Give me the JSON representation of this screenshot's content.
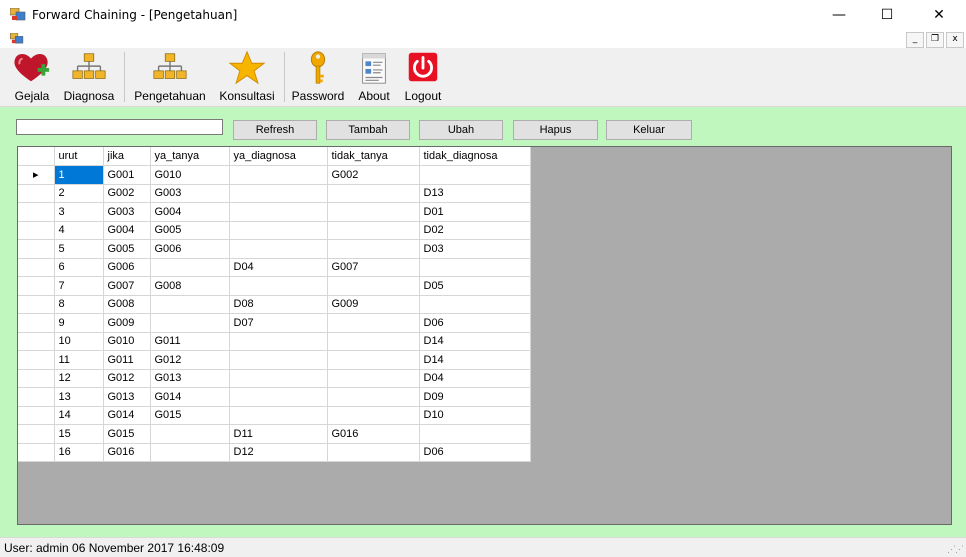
{
  "window": {
    "title": "Forward Chaining - [Pengetahuan]",
    "controls": {
      "minimize": "—",
      "maximize": "☐",
      "close": "✕"
    }
  },
  "mdi_controls": {
    "minimize": "_",
    "restore": "❐",
    "close": "x"
  },
  "toolbar": {
    "items": [
      {
        "label": "Gejala",
        "icon": "heart-plus-icon"
      },
      {
        "label": "Diagnosa",
        "icon": "hierarchy-icon"
      },
      {
        "label": "Pengetahuan",
        "icon": "hierarchy-icon"
      },
      {
        "label": "Konsultasi",
        "icon": "star-icon"
      },
      {
        "label": "Password",
        "icon": "key-icon"
      },
      {
        "label": "About",
        "icon": "document-icon"
      },
      {
        "label": "Logout",
        "icon": "power-icon"
      }
    ]
  },
  "search": {
    "value": ""
  },
  "buttons": {
    "refresh": "Refresh",
    "tambah": "Tambah",
    "ubah": "Ubah",
    "hapus": "Hapus",
    "keluar": "Keluar"
  },
  "table": {
    "columns": [
      "urut",
      "jika",
      "ya_tanya",
      "ya_diagnosa",
      "tidak_tanya",
      "tidak_diagnosa"
    ],
    "rows": [
      [
        "1",
        "G001",
        "G010",
        "",
        "G002",
        ""
      ],
      [
        "2",
        "G002",
        "G003",
        "",
        "",
        "D13"
      ],
      [
        "3",
        "G003",
        "G004",
        "",
        "",
        "D01"
      ],
      [
        "4",
        "G004",
        "G005",
        "",
        "",
        "D02"
      ],
      [
        "5",
        "G005",
        "G006",
        "",
        "",
        "D03"
      ],
      [
        "6",
        "G006",
        "",
        "D04",
        "G007",
        ""
      ],
      [
        "7",
        "G007",
        "G008",
        "",
        "",
        "D05"
      ],
      [
        "8",
        "G008",
        "",
        "D08",
        "G009",
        ""
      ],
      [
        "9",
        "G009",
        "",
        "D07",
        "",
        "D06"
      ],
      [
        "10",
        "G010",
        "G011",
        "",
        "",
        "D14"
      ],
      [
        "11",
        "G011",
        "G012",
        "",
        "",
        "D14"
      ],
      [
        "12",
        "G012",
        "G013",
        "",
        "",
        "D04"
      ],
      [
        "13",
        "G013",
        "G014",
        "",
        "",
        "D09"
      ],
      [
        "14",
        "G014",
        "G015",
        "",
        "",
        "D10"
      ],
      [
        "15",
        "G015",
        "",
        "D11",
        "G016",
        ""
      ],
      [
        "16",
        "G016",
        "",
        "D12",
        "",
        "D06"
      ]
    ],
    "current_row_marker": "▸"
  },
  "status": {
    "text": "User: admin  06 November 2017 16:48:09"
  },
  "colors": {
    "client_bg": "#bff7bf",
    "grid_bg": "#ababab",
    "selection": "#0078d7",
    "logout_red": "#e81123"
  }
}
